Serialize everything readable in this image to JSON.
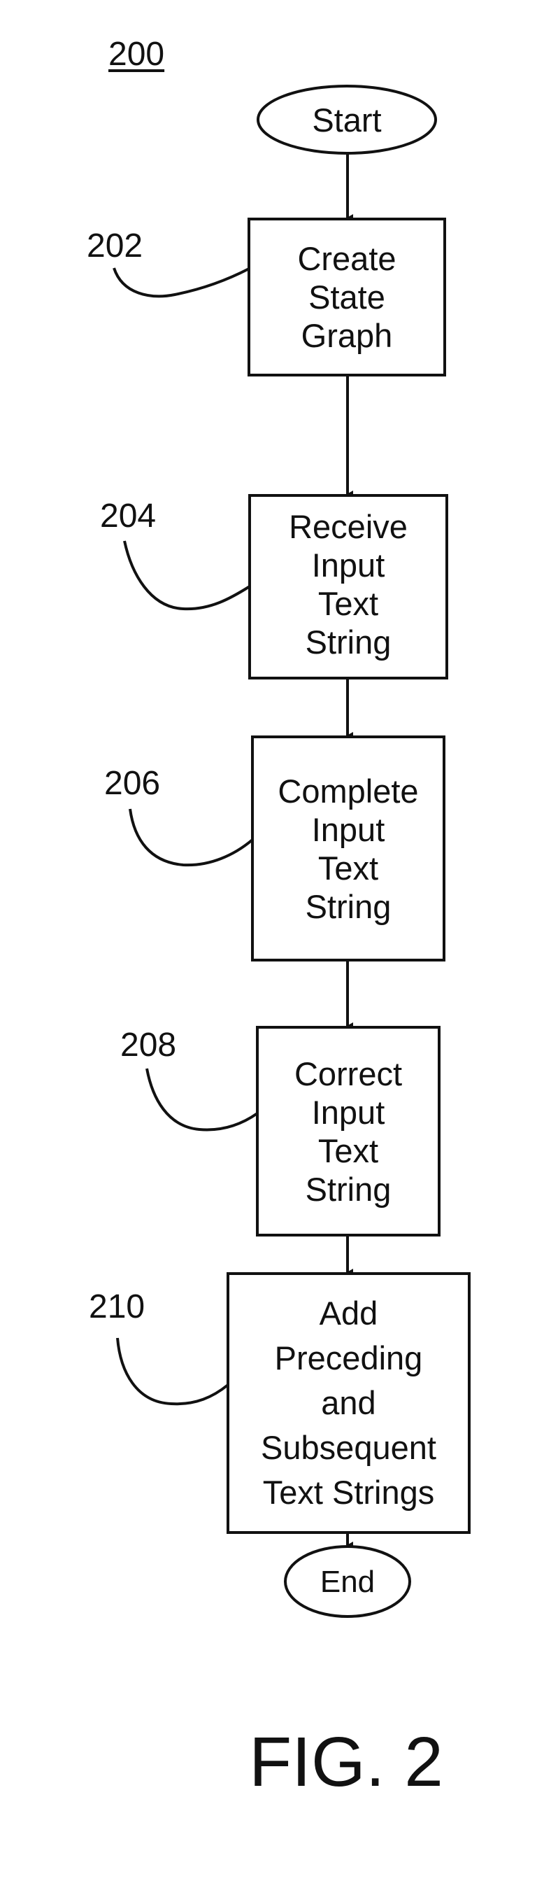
{
  "figure": {
    "reference": "200",
    "caption": "FIG. 2"
  },
  "flowchart": {
    "start": {
      "label": "Start"
    },
    "steps": [
      {
        "ref": "202",
        "lines": [
          "Create",
          "State",
          "Graph"
        ]
      },
      {
        "ref": "204",
        "lines": [
          "Receive",
          "Input",
          "Text",
          "String"
        ]
      },
      {
        "ref": "206",
        "lines": [
          "Complete",
          "Input",
          "Text",
          "String"
        ]
      },
      {
        "ref": "208",
        "lines": [
          "Correct",
          "Input",
          "Text",
          "String"
        ]
      },
      {
        "ref": "210",
        "lines": [
          "Add",
          "Preceding",
          "and",
          "Subsequent",
          "Text Strings"
        ]
      }
    ],
    "end": {
      "label": "End"
    },
    "edges": [
      [
        "start",
        "202"
      ],
      [
        "202",
        "204"
      ],
      [
        "204",
        "206"
      ],
      [
        "206",
        "208"
      ],
      [
        "208",
        "210"
      ],
      [
        "210",
        "end"
      ]
    ]
  }
}
